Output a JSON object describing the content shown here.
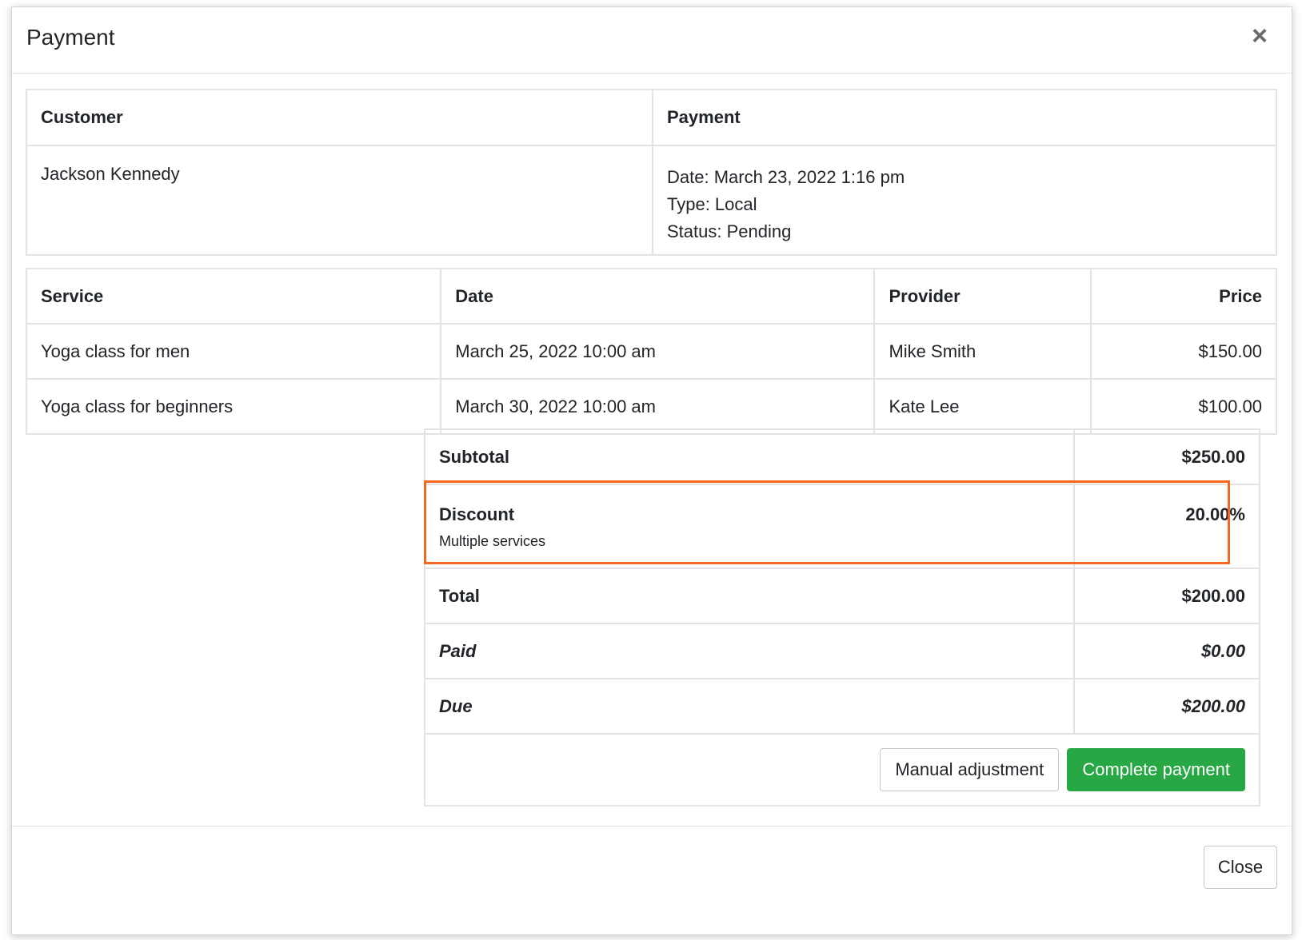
{
  "modal": {
    "title": "Payment",
    "close_icon": "×"
  },
  "info": {
    "headers": {
      "customer": "Customer",
      "payment": "Payment"
    },
    "customer_name": "Jackson Kennedy",
    "payment_lines": [
      "Date: March 23, 2022 1:16 pm",
      "Type: Local",
      "Status: Pending"
    ]
  },
  "services": {
    "headers": {
      "service": "Service",
      "date": "Date",
      "provider": "Provider",
      "price": "Price"
    },
    "rows": [
      {
        "service": "Yoga class for men",
        "date": "March 25, 2022 10:00 am",
        "provider": "Mike Smith",
        "price": "$150.00"
      },
      {
        "service": "Yoga class for beginners",
        "date": "March 30, 2022 10:00 am",
        "provider": "Kate Lee",
        "price": "$100.00"
      }
    ]
  },
  "summary": {
    "subtotal_label": "Subtotal",
    "subtotal_value": "$250.00",
    "discount_label": "Discount",
    "discount_note": "Multiple services",
    "discount_value": "20.00%",
    "total_label": "Total",
    "total_value": "$200.00",
    "paid_label": "Paid",
    "paid_value": "$0.00",
    "due_label": "Due",
    "due_value": "$200.00"
  },
  "actions": {
    "manual_adjustment": "Manual adjustment",
    "complete_payment": "Complete payment"
  },
  "footer": {
    "close_label": "Close"
  },
  "colors": {
    "highlight": "#f26722",
    "success": "#28a745"
  }
}
